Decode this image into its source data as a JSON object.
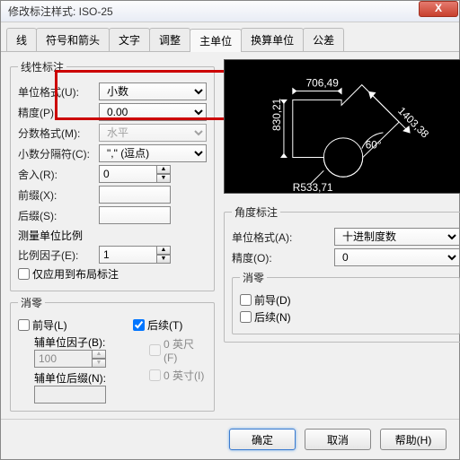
{
  "window": {
    "title": "修改标注样式: ISO-25"
  },
  "tabs": [
    "线",
    "符号和箭头",
    "文字",
    "调整",
    "主单位",
    "换算单位",
    "公差"
  ],
  "active_tab": "主单位",
  "linear": {
    "legend": "线性标注",
    "unit_format_label": "单位格式(U):",
    "unit_format": "小数",
    "precision_label": "精度(P):",
    "precision": "0.00",
    "fraction_format_label": "分数格式(M):",
    "fraction_format": "水平",
    "decimal_sep_label": "小数分隔符(C):",
    "decimal_sep": "\",\" (逗点)",
    "roundoff_label": "舍入(R):",
    "roundoff": "0",
    "prefix_label": "前缀(X):",
    "prefix": "",
    "suffix_label": "后缀(S):",
    "suffix": ""
  },
  "scale": {
    "legend": "测量单位比例",
    "factor_label": "比例因子(E):",
    "factor": "1",
    "layout_only": "仅应用到布局标注"
  },
  "zero_l": {
    "legend": "消零",
    "leading": "前导(L)",
    "trailing": "后续(T)",
    "sub_factor_label": "辅单位因子(B):",
    "sub_factor": "100",
    "sub_suffix_label": "辅单位后缀(N):",
    "sub_suffix": "",
    "feet": "0 英尺(F)",
    "inches": "0 英寸(I)"
  },
  "preview": {
    "d1": "706,49",
    "d2": "830,21",
    "d3": "1403,38",
    "d4": "R533,71",
    "d5": "60°"
  },
  "angular": {
    "legend": "角度标注",
    "unit_format_label": "单位格式(A):",
    "unit_format": "十进制度数",
    "precision_label": "精度(O):",
    "precision": "0"
  },
  "zero_a": {
    "legend": "消零",
    "leading": "前导(D)",
    "trailing": "后续(N)"
  },
  "buttons": {
    "ok": "确定",
    "cancel": "取消",
    "help": "帮助(H)"
  }
}
